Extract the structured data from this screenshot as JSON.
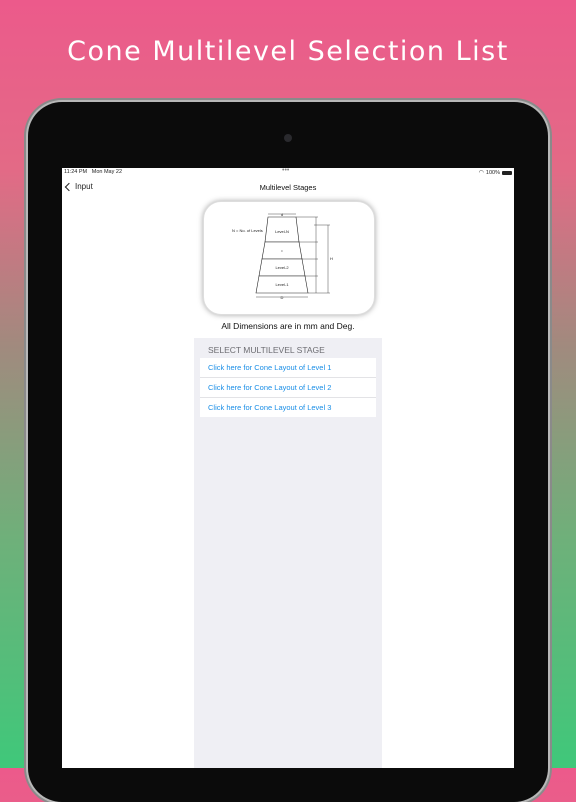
{
  "headline": "Cone Multilevel Selection List",
  "status": {
    "time": "11:24 PM",
    "date": "Mon May 22",
    "dots": "•••",
    "battery": "100%"
  },
  "nav": {
    "back_label": "Input",
    "title": "Multilevel Stages"
  },
  "diagram": {
    "legend": "N = No. of Levels",
    "levels": [
      "Level-N",
      "•",
      "Level-2",
      "Level-1"
    ],
    "dim_top": "d",
    "dim_bottom": "D",
    "dim_height": "H"
  },
  "caption": "All Dimensions are in mm and Deg.",
  "list": {
    "section_header": "SELECT MULTILEVEL STAGE",
    "items": [
      "Click here for Cone Layout of Level 1",
      "Click here for Cone Layout of Level 2",
      "Click here for Cone Layout of Level 3"
    ]
  }
}
